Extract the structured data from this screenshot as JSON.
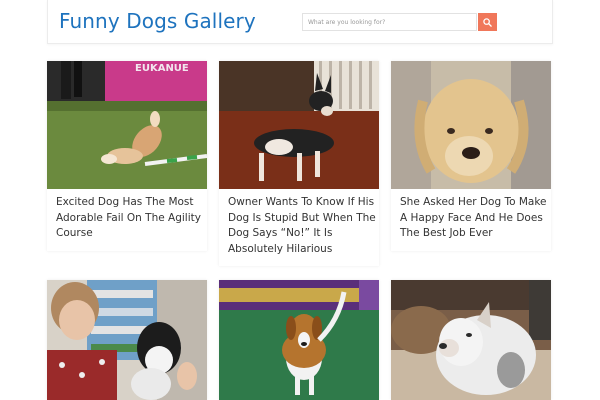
{
  "header": {
    "site_title": "Funny Dogs Gallery",
    "search_placeholder": "What are you looking for?",
    "search_icon": "search-icon",
    "accent_color": "#f0775a",
    "title_color": "#1e73be"
  },
  "posts": [
    {
      "title": "Excited Dog Has The Most Adorable Fail On The Agility Course"
    },
    {
      "title": "Owner Wants To Know If His Dog Is Stupid But When The Dog Says “No!” It Is Absolutely Hilarious"
    },
    {
      "title": "She Asked Her Dog To Make A Happy Face And He Does The Best Job Ever"
    },
    {
      "title": ""
    },
    {
      "title": ""
    },
    {
      "title": ""
    }
  ]
}
